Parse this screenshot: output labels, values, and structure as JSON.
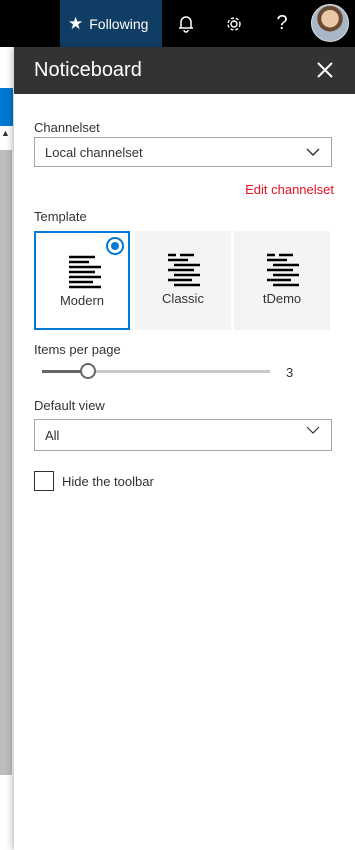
{
  "topbar": {
    "following_label": "Following",
    "icons": [
      "star-icon",
      "bell-icon",
      "gear-icon",
      "help-icon",
      "avatar"
    ]
  },
  "panel": {
    "title": "Noticeboard",
    "channelset": {
      "label": "Channelset",
      "value": "Local channelset",
      "edit_link": "Edit channelset"
    },
    "template": {
      "label": "Template",
      "options": [
        {
          "name": "Modern",
          "selected": true
        },
        {
          "name": "Classic",
          "selected": false
        },
        {
          "name": "tDemo",
          "selected": false
        }
      ]
    },
    "items_per_page": {
      "label": "Items per page",
      "value": "3",
      "level": 0.2
    },
    "default_view": {
      "label": "Default view",
      "value": "All"
    },
    "hide_toolbar": {
      "label": "Hide the toolbar",
      "checked": false
    }
  },
  "colors": {
    "accent": "#0078d4",
    "header_bg": "#333333",
    "topbar_bg": "#000000",
    "following_bg": "#0f3d63",
    "link": "#e81123"
  }
}
